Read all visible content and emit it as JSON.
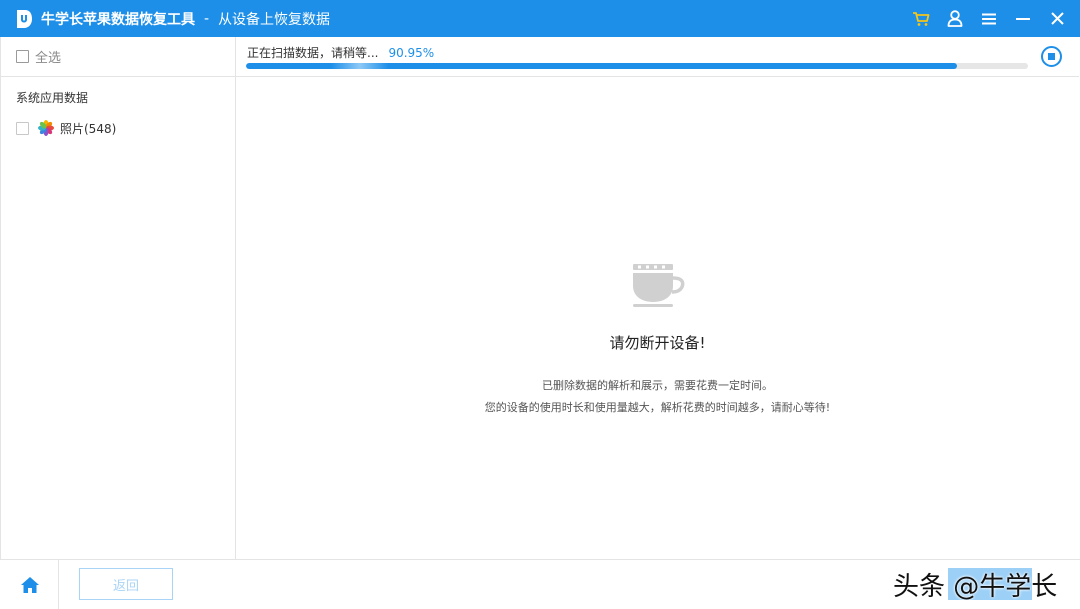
{
  "window": {
    "app_title": "牛学长苹果数据恢复工具",
    "separator": "-",
    "subtitle": "从设备上恢复数据",
    "controls": [
      "cart-icon",
      "user-icon",
      "menu-icon",
      "minimize-icon",
      "close-icon"
    ],
    "accent_color": "#1e8fe8",
    "cart_color": "#f5c518"
  },
  "sidebar": {
    "select_all_label": "全选",
    "category_heading": "系统应用数据",
    "items": [
      {
        "label": "照片(548)",
        "icon": "photos-icon"
      }
    ]
  },
  "scan": {
    "status_text": "正在扫描数据，请稍等...",
    "percent_text": "90.95%",
    "progress": 0.9095
  },
  "message": {
    "title": "请勿断开设备!",
    "line1": "已删除数据的解析和展示，需要花费一定时间。",
    "line2": "您的设备的使用时长和使用量越大，解析花费的时间越多，请耐心等待!"
  },
  "footer": {
    "back_label": "返回",
    "watermark": "头条 @牛学长"
  }
}
